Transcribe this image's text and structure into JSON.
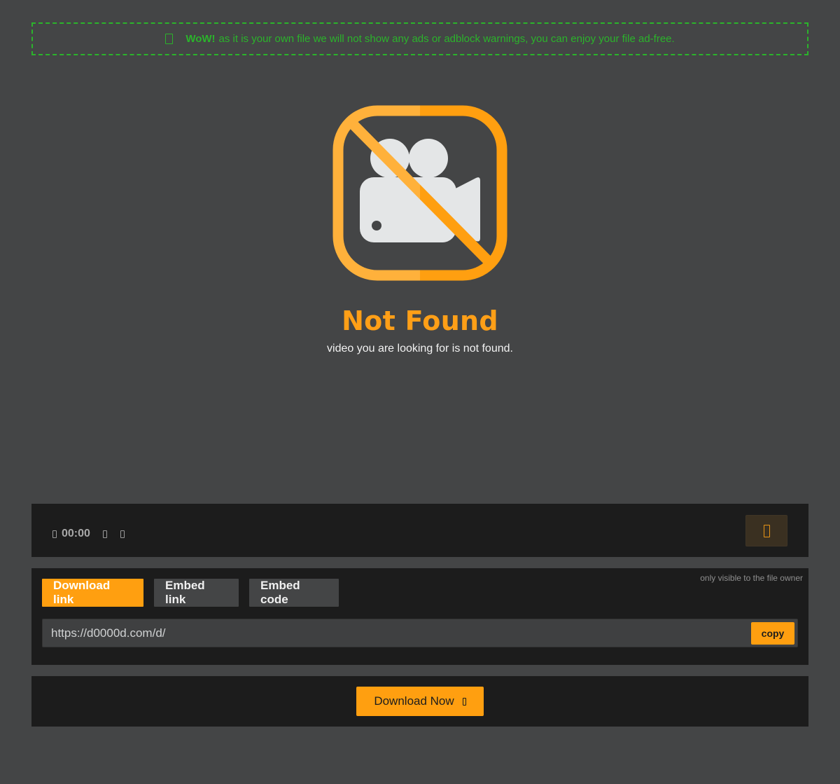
{
  "notice": {
    "highlight": "WoW!",
    "message": "as it is your own file we will not show any ads or adblock warnings, you can enjoy your file ad-free.",
    "color": "#2bb32b"
  },
  "graphic": {
    "icon": "video-camera-crossed-icon",
    "accent_left": "#ffb13b",
    "accent_right": "#ff9f10"
  },
  "status": {
    "title": "Not Found",
    "subtitle": "video you are looking for is not found."
  },
  "player": {
    "time": "00:00"
  },
  "share": {
    "owner_note": "only visible to the file owner",
    "tabs": [
      {
        "label": "Download link",
        "active": true
      },
      {
        "label": "Embed link",
        "active": false
      },
      {
        "label": "Embed code",
        "active": false
      }
    ],
    "link_value": "https://d0000d.com/d/",
    "copy_label": "copy"
  },
  "download": {
    "button_label": "Download Now"
  }
}
